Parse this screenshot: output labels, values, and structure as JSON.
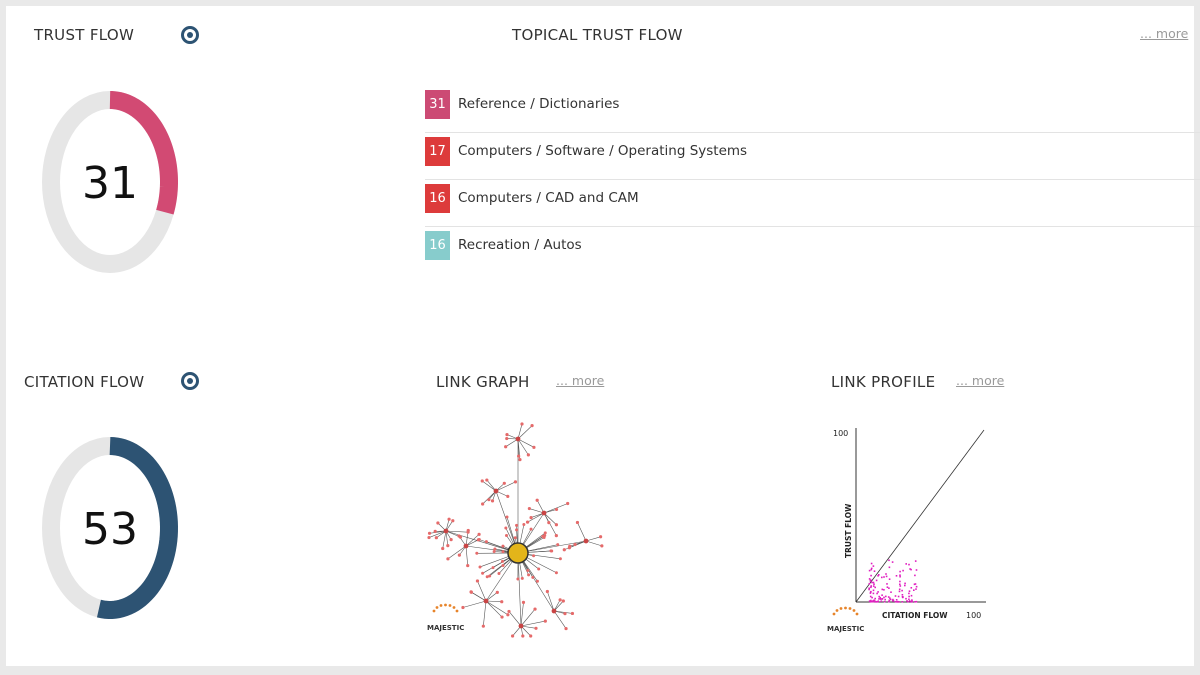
{
  "trust_flow": {
    "title": "TRUST FLOW",
    "value": "31",
    "score": 31,
    "color": "#d24a73"
  },
  "citation_flow": {
    "title": "CITATION FLOW",
    "value": "53",
    "score": 53,
    "color": "#2d5373"
  },
  "topical": {
    "title": "TOPICAL TRUST FLOW",
    "more": "... more",
    "items": [
      {
        "score": "31",
        "label": "Reference / Dictionaries",
        "color": "#cc4a74"
      },
      {
        "score": "17",
        "label": "Computers / Software / Operating Systems",
        "color": "#dd3b3b"
      },
      {
        "score": "16",
        "label": "Computers / CAD and CAM",
        "color": "#dd3b3b"
      },
      {
        "score": "16",
        "label": "Recreation / Autos",
        "color": "#87cccc"
      }
    ]
  },
  "link_graph": {
    "title": "LINK GRAPH",
    "more": "... more",
    "brand": "MAJESTIC"
  },
  "link_profile": {
    "title": "LINK PROFILE",
    "more": "... more",
    "brand": "MAJESTIC",
    "chart_data": {
      "type": "scatter",
      "xlabel": "CITATION FLOW",
      "ylabel": "TRUST FLOW",
      "xmax_label": "100",
      "ymax_label": "100",
      "xlim": [
        0,
        100
      ],
      "ylim": [
        0,
        100
      ]
    }
  },
  "colors": {
    "info_icon": "#2d5373",
    "track": "#e6e6e6",
    "scatter": "#e020c0"
  },
  "icons": {
    "info": "info-ring-icon"
  }
}
